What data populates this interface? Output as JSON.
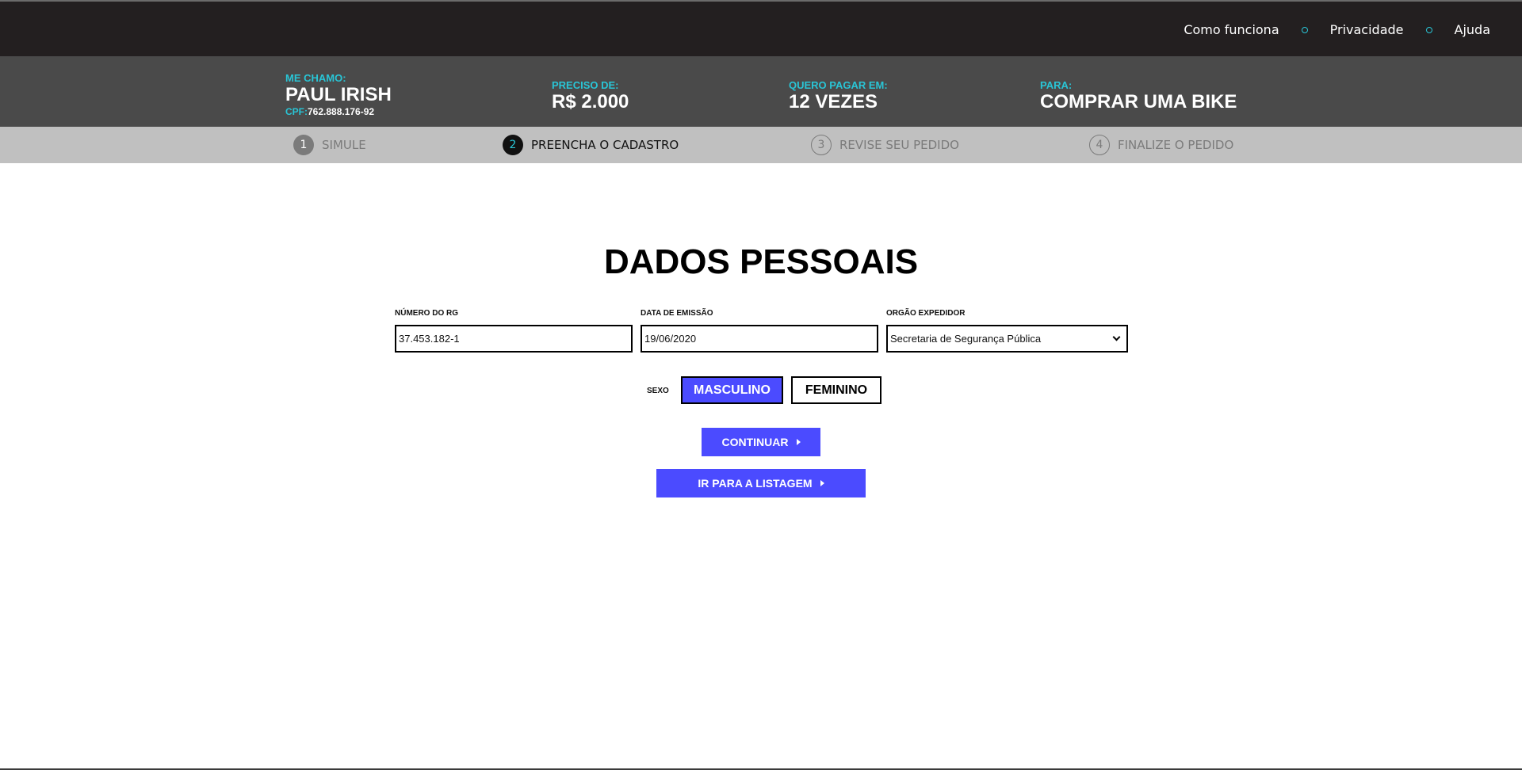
{
  "nav": {
    "links": [
      "Como funciona",
      "Privacidade",
      "Ajuda"
    ],
    "separator_color": "#29c5d6",
    "background": "#231f20"
  },
  "summary": {
    "name_label": "ME CHAMO:",
    "name_value": "PAUL IRISH",
    "cpf_label": "CPF:",
    "cpf_value": "762.888.176-92",
    "amount_label": "PRECISO DE:",
    "amount_value": "R$ 2.000",
    "installments_label": "QUERO PAGAR EM:",
    "installments_value": "12 VEZES",
    "purpose_label": "PARA:",
    "purpose_value": "COMPRAR UMA BIKE"
  },
  "steps": [
    {
      "number": "1",
      "label": "SIMULE",
      "state": "done"
    },
    {
      "number": "2",
      "label": "PREENCHA O CADASTRO",
      "state": "active"
    },
    {
      "number": "3",
      "label": "REVISE SEU PEDIDO",
      "state": "todo"
    },
    {
      "number": "4",
      "label": "FINALIZE O PEDIDO",
      "state": "todo"
    }
  ],
  "form": {
    "title": "DADOS PESSOAIS",
    "rg_label": "NÚMERO DO RG",
    "rg_value": "37.453.182-1",
    "emission_label": "DATA DE EMISSÃO",
    "emission_value": "19/06/2020",
    "issuer_label": "ORGÃO EXPEDIDOR",
    "issuer_value": "Secretaria de Segurança Pública",
    "sex_label": "SEXO",
    "sex_options": [
      "MASCULINO",
      "FEMININO"
    ],
    "sex_selected": "MASCULINO",
    "continue_label": "CONTINUAR",
    "list_label": "IR PARA A LISTAGEM"
  },
  "colors": {
    "accent": "#4b4bff",
    "cyan": "#29c5d6",
    "summary_bg": "#4a4a4a",
    "steps_bg": "#c0c0c0"
  },
  "icons": {
    "select_caret": "chevron-down-icon",
    "button_arrow": "caret-right-icon",
    "nav_separator": "circle-dot-icon"
  }
}
